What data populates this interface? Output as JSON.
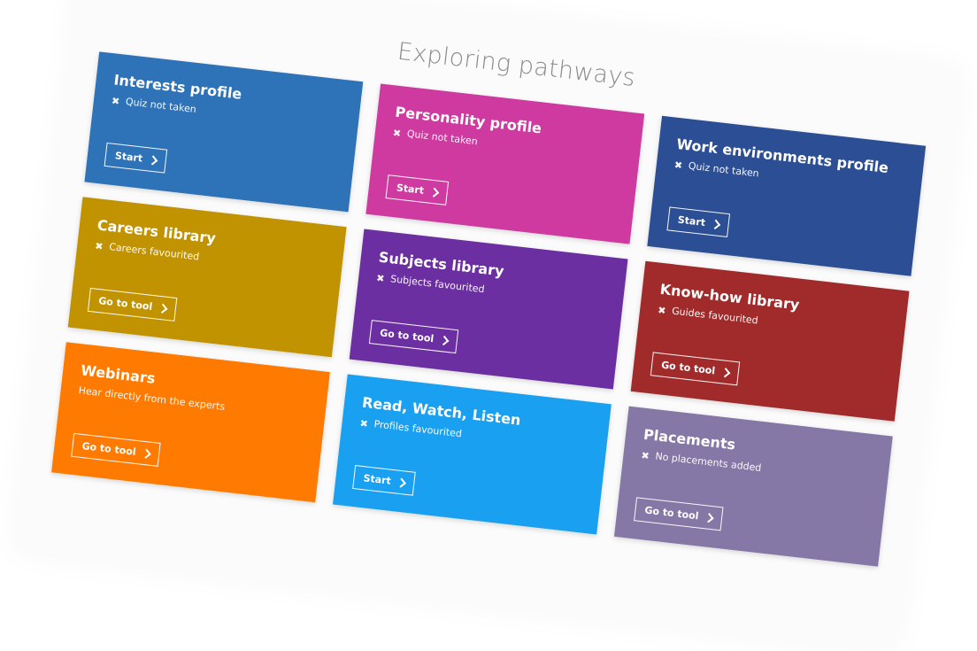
{
  "page": {
    "title": "Exploring pathways"
  },
  "cards": [
    {
      "title": "Interests profile",
      "status_icon": "x-icon",
      "status": "Quiz not taken",
      "button": "Start",
      "color": "#2e72b8"
    },
    {
      "title": "Personality profile",
      "status_icon": "x-icon",
      "status": "Quiz not taken",
      "button": "Start",
      "color": "#cf3aa0"
    },
    {
      "title": "Work environments profile",
      "status_icon": "x-icon",
      "status": "Quiz not taken",
      "button": "Start",
      "color": "#2c4e94"
    },
    {
      "title": "Careers library",
      "status_icon": "x-icon",
      "status": "Careers favourited",
      "button": "Go to tool",
      "color": "#c29300"
    },
    {
      "title": "Subjects library",
      "status_icon": "x-icon",
      "status": "Subjects favourited",
      "button": "Go to tool",
      "color": "#6b2fa1"
    },
    {
      "title": "Know-how library",
      "status_icon": "x-icon",
      "status": "Guides favourited",
      "button": "Go to tool",
      "color": "#a12b2b"
    },
    {
      "title": "Webinars",
      "status_icon": "",
      "status": "Hear directly from the experts",
      "button": "Go to tool",
      "color": "#ff7a00"
    },
    {
      "title": "Read, Watch, Listen",
      "status_icon": "x-icon",
      "status": "Profiles favourited",
      "button": "Start",
      "color": "#1aa0f0"
    },
    {
      "title": "Placements",
      "status_icon": "x-icon",
      "status": "No placements added",
      "button": "Go to tool",
      "color": "#8577a6"
    }
  ],
  "icons": {
    "x": "✖",
    "chevron": "chevron-right-icon"
  }
}
